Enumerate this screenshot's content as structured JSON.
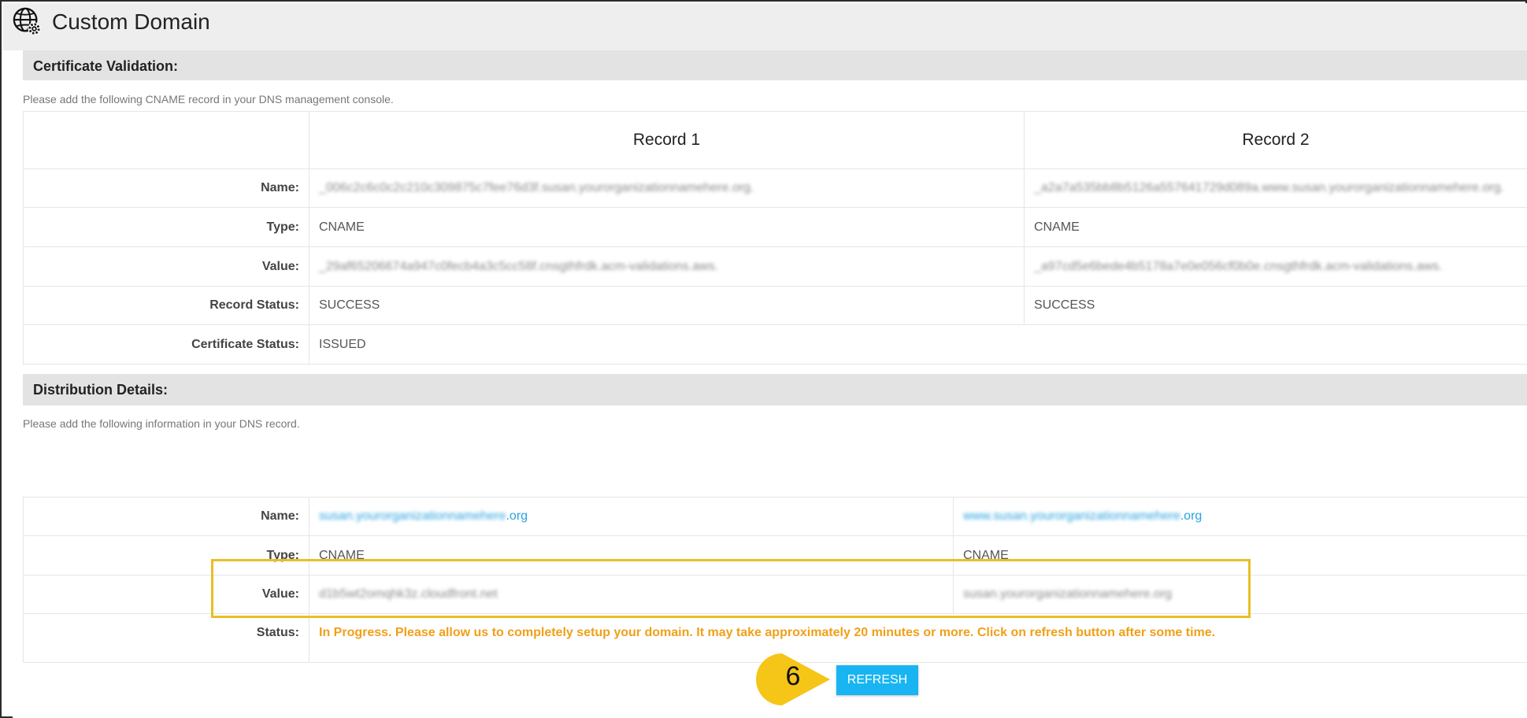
{
  "header": {
    "title": "Custom Domain"
  },
  "certificate_validation": {
    "section_title": "Certificate Validation:",
    "helper": "Please add the following CNAME record in your DNS management console.",
    "columns": [
      "Record 1",
      "Record 2"
    ],
    "rows": [
      {
        "label": "Name:",
        "values": [
          "_006c2c6c0c2c210c309875c7fee76d3f.susan.yourorganizationnamehere.org.",
          "_a2a7a535bb8b5126a557641729d089a.www.susan.yourorganizationnamehere.org."
        ]
      },
      {
        "label": "Type:",
        "values": [
          "CNAME",
          "CNAME"
        ]
      },
      {
        "label": "Value:",
        "values": [
          "_29af65206674a947c0fecb4a3c5cc58f.cnsgthfrdk.acm-validations.aws.",
          "_a97cd5e6bede4b5178a7e0e056cf0b0e.cnsgthfrdk.acm-validations.aws."
        ]
      },
      {
        "label": "Record Status:",
        "values": [
          "SUCCESS",
          "SUCCESS"
        ]
      }
    ],
    "certificate_status_label": "Certificate Status:",
    "certificate_status_value": "ISSUED"
  },
  "distribution_details": {
    "section_title": "Distribution Details:",
    "helper": "Please add the following information in your DNS record.",
    "name_label": "Name:",
    "name_values": [
      {
        "domain": "susan.yourorganizationnamehere",
        "tld": ".org"
      },
      {
        "domain": "www.susan.yourorganizationnamehere",
        "tld": ".org"
      }
    ],
    "type_label": "Type:",
    "type_values": [
      "CNAME",
      "CNAME"
    ],
    "value_label": "Value:",
    "value_values": [
      "d1b5wt2omqhk3z.cloudfront.net",
      "susan.yourorganizationnamehere.org"
    ],
    "status_label": "Status:",
    "status_message": "In Progress. Please allow us to completely setup your domain. It may take approximately 20 minutes or more. Click on refresh button after some time."
  },
  "actions": {
    "refresh_label": "REFRESH"
  },
  "callout": {
    "step_number": "6"
  },
  "icons": {
    "logo": "globe-gear-icon"
  },
  "colors": {
    "status_text": "#f0a018",
    "refresh_button": "#18b5f2",
    "highlight_border": "#e8bf25",
    "callout_fill": "#f5c518",
    "link": "#29a3e0"
  }
}
